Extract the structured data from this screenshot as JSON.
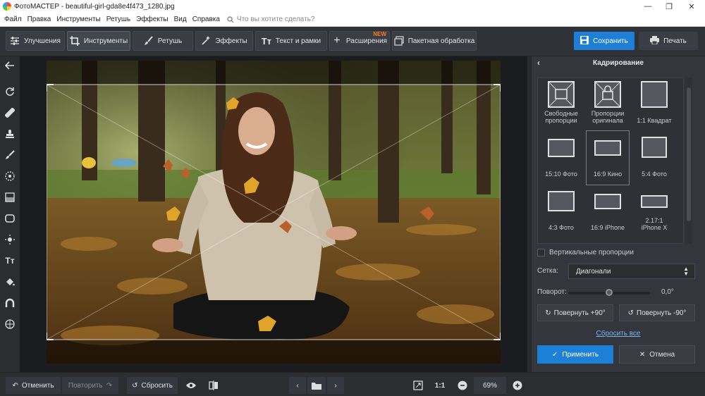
{
  "window": {
    "title": "ФотоМАСТЕР - beautiful-girl-gda8e4f473_1280.jpg"
  },
  "menu": {
    "items": [
      "Файл",
      "Правка",
      "Инструменты",
      "Ретушь",
      "Эффекты",
      "Вид",
      "Справка"
    ],
    "search_placeholder": "Что вы хотите сделать?"
  },
  "toolbar": {
    "tabs": [
      {
        "label": "Улучшения",
        "icon": "sliders-icon"
      },
      {
        "label": "Инструменты",
        "icon": "crop-icon",
        "active": true
      },
      {
        "label": "Ретушь",
        "icon": "brush-icon"
      },
      {
        "label": "Эффекты",
        "icon": "sparkle-icon"
      },
      {
        "label": "Текст и рамки",
        "icon": "text-icon"
      },
      {
        "label": "Расширения",
        "icon": "plus-icon",
        "badge": "NEW"
      },
      {
        "label": "Пакетная обработка",
        "icon": "batch-icon"
      }
    ],
    "save_label": "Сохранить",
    "print_label": "Печать"
  },
  "panel": {
    "title": "Кадрирование",
    "presets": [
      "Свободные пропорции",
      "Пропорции оригинала",
      "1:1 Квадрат",
      "15:10 Фото",
      "16:9 Кино",
      "5:4 Фото",
      "4:3 Фото",
      "16:9 iPhone",
      "2.17:1 iPhone X"
    ],
    "selected_preset": "16:9 Кино",
    "vertical_label": "Вертикальные пропорции",
    "grid_label": "Сетка:",
    "grid_value": "Диагонали",
    "rotate_label": "Поворот:",
    "rotate_value": "0,0°",
    "rotate_cw_label": "Повернуть +90°",
    "rotate_ccw_label": "Повернуть -90°",
    "reset_all_label": "Сбросить все",
    "apply_label": "Применить",
    "cancel_label": "Отмена"
  },
  "bottom": {
    "undo_label": "Отменить",
    "redo_label": "Повторить",
    "reset_label": "Сбросить",
    "ratio_label": "1:1",
    "zoom_value": "69%"
  },
  "colors": {
    "accent": "#1d7fd6",
    "new_badge": "#ff7d1a"
  }
}
